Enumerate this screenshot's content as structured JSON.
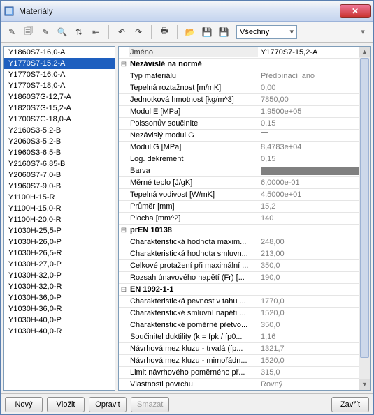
{
  "window": {
    "title": "Materiály"
  },
  "toolbar": {
    "filter_label": "Všechny"
  },
  "list": {
    "items": [
      "Y1860S7-16,0-A",
      "Y1770S7-15,2-A",
      "Y1770S7-16,0-A",
      "Y1770S7-18,0-A",
      "Y1860S7G-12,7-A",
      "Y1820S7G-15,2-A",
      "Y1700S7G-18,0-A",
      "Y2160S3-5,2-B",
      "Y2060S3-5,2-B",
      "Y1960S3-6,5-B",
      "Y2160S7-6,85-B",
      "Y2060S7-7,0-B",
      "Y1960S7-9,0-B",
      "Y1100H-15-R",
      "Y1100H-15,0-R",
      "Y1100H-20,0-R",
      "Y1030H-25,5-P",
      "Y1030H-26,0-P",
      "Y1030H-26,5-R",
      "Y1030H-27,0-P",
      "Y1030H-32,0-P",
      "Y1030H-32,0-R",
      "Y1030H-36,0-P",
      "Y1030H-36,0-R",
      "Y1030H-40,0-P",
      "Y1030H-40,0-R"
    ],
    "selected_index": 1
  },
  "props": {
    "header_name": "Jméno",
    "header_val": "Y1770S7-15,2-A",
    "rows": [
      {
        "type": "group",
        "exp": "⊟",
        "name": "Nezávislé na normě",
        "val": ""
      },
      {
        "type": "prop",
        "exp": "",
        "name": "Typ materiálu",
        "val": "Předpínací lano"
      },
      {
        "type": "prop",
        "exp": "",
        "name": "Tepelná roztažnost [m/mK]",
        "val": "0,00"
      },
      {
        "type": "prop",
        "exp": "",
        "name": "Jednotková hmotnost [kg/m^3]",
        "val": "7850,00"
      },
      {
        "type": "prop",
        "exp": "",
        "name": "Modul E [MPa]",
        "val": "1,9500e+05"
      },
      {
        "type": "prop",
        "exp": "",
        "name": "Poissonův součinitel",
        "val": "0,15"
      },
      {
        "type": "check",
        "exp": "",
        "name": "Nezávislý modul G",
        "val": "false"
      },
      {
        "type": "prop",
        "exp": "",
        "name": "Modul G [MPa]",
        "val": "8,4783e+04"
      },
      {
        "type": "prop",
        "exp": "",
        "name": "Log. dekrement",
        "val": "0,15"
      },
      {
        "type": "color",
        "exp": "",
        "name": "Barva",
        "val": "#808080"
      },
      {
        "type": "prop",
        "exp": "",
        "name": "Měrné teplo [J/gK]",
        "val": "6,0000e-01"
      },
      {
        "type": "prop",
        "exp": "",
        "name": "Tepelná vodivost [W/mK]",
        "val": "4,5000e+01"
      },
      {
        "type": "prop",
        "exp": "",
        "name": "Průměr [mm]",
        "val": "15,2"
      },
      {
        "type": "prop",
        "exp": "",
        "name": "Plocha [mm^2]",
        "val": "140"
      },
      {
        "type": "group",
        "exp": "⊟",
        "name": "prEN 10138",
        "val": ""
      },
      {
        "type": "prop",
        "exp": "",
        "name": "Charakteristická hodnota maxim...",
        "val": "248,00"
      },
      {
        "type": "prop",
        "exp": "",
        "name": "Charakteristická hodnota smluvn...",
        "val": "213,00"
      },
      {
        "type": "prop",
        "exp": "",
        "name": "Celkové protažení při maximální ...",
        "val": "350,0"
      },
      {
        "type": "prop",
        "exp": "",
        "name": "Rozsah únavového napětí (Fr) [...",
        "val": "190,0"
      },
      {
        "type": "group",
        "exp": "⊟",
        "name": "EN 1992-1-1",
        "val": ""
      },
      {
        "type": "prop",
        "exp": "",
        "name": "Charakteristická pevnost v tahu ...",
        "val": "1770,0"
      },
      {
        "type": "prop",
        "exp": "",
        "name": "Charakteristické smluvní napětí ...",
        "val": "1520,0"
      },
      {
        "type": "prop",
        "exp": "",
        "name": "Charakteristické poměrné přetvo...",
        "val": "350,0"
      },
      {
        "type": "prop",
        "exp": "",
        "name": "Součinitel duktility (k = fpk / fp0...",
        "val": "1,16"
      },
      {
        "type": "prop",
        "exp": "",
        "name": "Návrhová mez kluzu - trvalá (fp...",
        "val": "1321,7"
      },
      {
        "type": "prop",
        "exp": "",
        "name": "Návrhová mez kluzu - mimořádn...",
        "val": "1520,0"
      },
      {
        "type": "prop",
        "exp": "",
        "name": "Limit návrhového poměrného př...",
        "val": "315,0"
      },
      {
        "type": "prop",
        "exp": "",
        "name": "Vlastnosti povrchu",
        "val": "Rovný"
      }
    ]
  },
  "buttons": {
    "new": "Nový",
    "insert": "Vložit",
    "edit": "Opravit",
    "delete": "Smazat",
    "close": "Zavřít"
  }
}
